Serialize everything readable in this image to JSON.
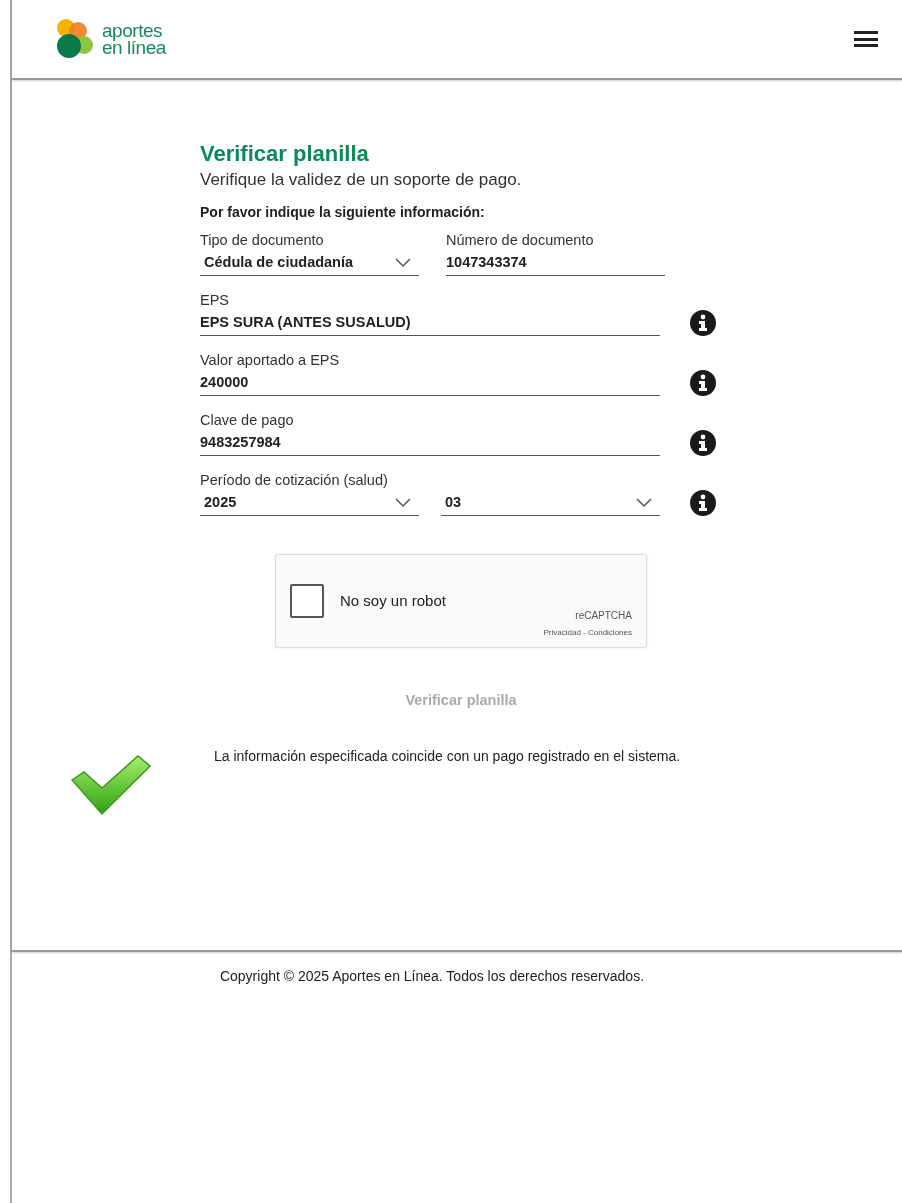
{
  "header": {
    "logo": {
      "line1": "aportes",
      "line2": "en línea"
    }
  },
  "form": {
    "title": "Verificar planilla",
    "subtitle": "Verifique la validez de un soporte de pago.",
    "instruction": "Por favor indique la siguiente información:",
    "rows": [
      {
        "info": false,
        "fields": [
          {
            "kind": "select",
            "label": "Tipo de documento",
            "value": "Cédula de ciudadanía"
          },
          {
            "kind": "text",
            "label": "Número de documento",
            "value": "1047343374"
          }
        ]
      },
      {
        "info": true,
        "fields": [
          {
            "kind": "text",
            "label": "EPS",
            "value": "EPS SURA (ANTES SUSALUD)"
          }
        ]
      },
      {
        "info": true,
        "fields": [
          {
            "kind": "text",
            "label": "Valor aportado a EPS",
            "value": "240000"
          }
        ]
      },
      {
        "info": true,
        "fields": [
          {
            "kind": "text",
            "label": "Clave de pago",
            "value": "9483257984"
          }
        ]
      },
      {
        "info": true,
        "label": "Período de cotización (salud)",
        "fields": [
          {
            "kind": "select",
            "value": "2025"
          },
          {
            "kind": "select",
            "value": "03"
          }
        ]
      }
    ],
    "captcha": {
      "label": "No soy un robot",
      "checked": false,
      "brand": "reCAPTCHA",
      "links": "Privacidad - Condiciones"
    },
    "submit": {
      "label": "Verificar planilla",
      "disabled": true
    },
    "result": {
      "kind": "success",
      "message": "La información especificada coincide con un pago registrado en el sistema."
    }
  },
  "footer": {
    "copyright": "Copyright © 2025 Aportes en Línea. Todos los derechos reservados."
  }
}
